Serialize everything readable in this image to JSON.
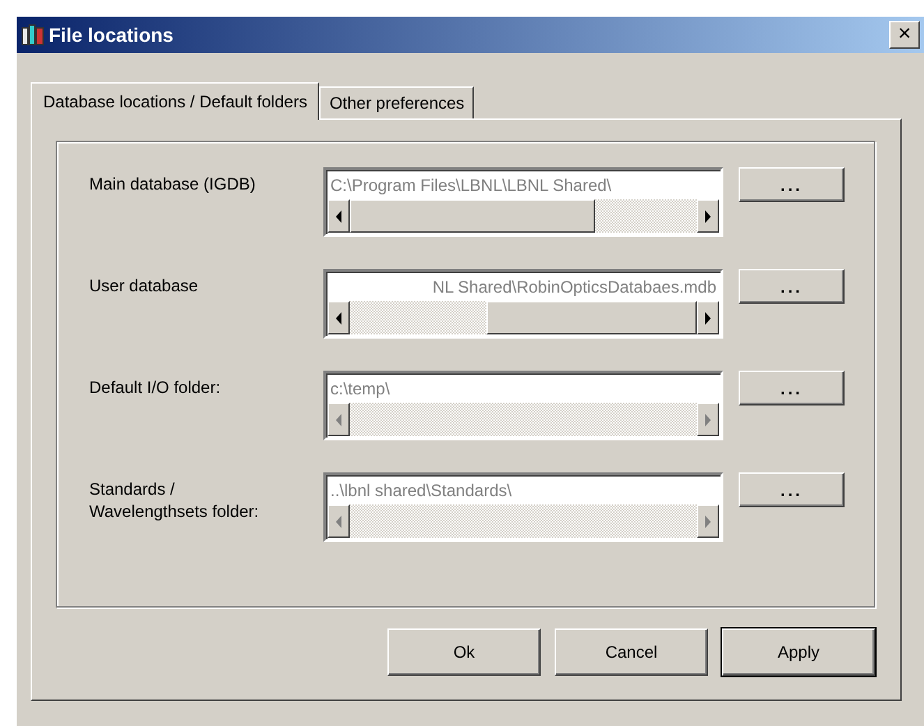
{
  "window": {
    "title": "File locations",
    "close": "×"
  },
  "tabs": [
    {
      "label": "Database locations / Default folders",
      "selected": true
    },
    {
      "label": "Other preferences",
      "selected": false
    }
  ],
  "rows": [
    {
      "label": "Main database (IGDB)",
      "value": "C:\\Program Files\\LBNL\\LBNL Shared\\",
      "scrollable": true,
      "scrolled_to_end": false,
      "browse": "..."
    },
    {
      "label": "User database",
      "value": "NL Shared\\RobinOpticsDatabaes.mdb",
      "scrollable": true,
      "scrolled_to_end": true,
      "browse": "..."
    },
    {
      "label": "Default I/O folder:",
      "value": "c:\\temp\\",
      "scrollable": false,
      "browse": "..."
    },
    {
      "label": "Standards / Wavelengthsets folder:",
      "value": "..\\lbnl shared\\Standards\\",
      "scrollable": false,
      "browse": "..."
    }
  ],
  "buttons": [
    {
      "label": "Ok",
      "default": false
    },
    {
      "label": "Cancel",
      "default": false
    },
    {
      "label": "Apply",
      "default": true
    }
  ]
}
